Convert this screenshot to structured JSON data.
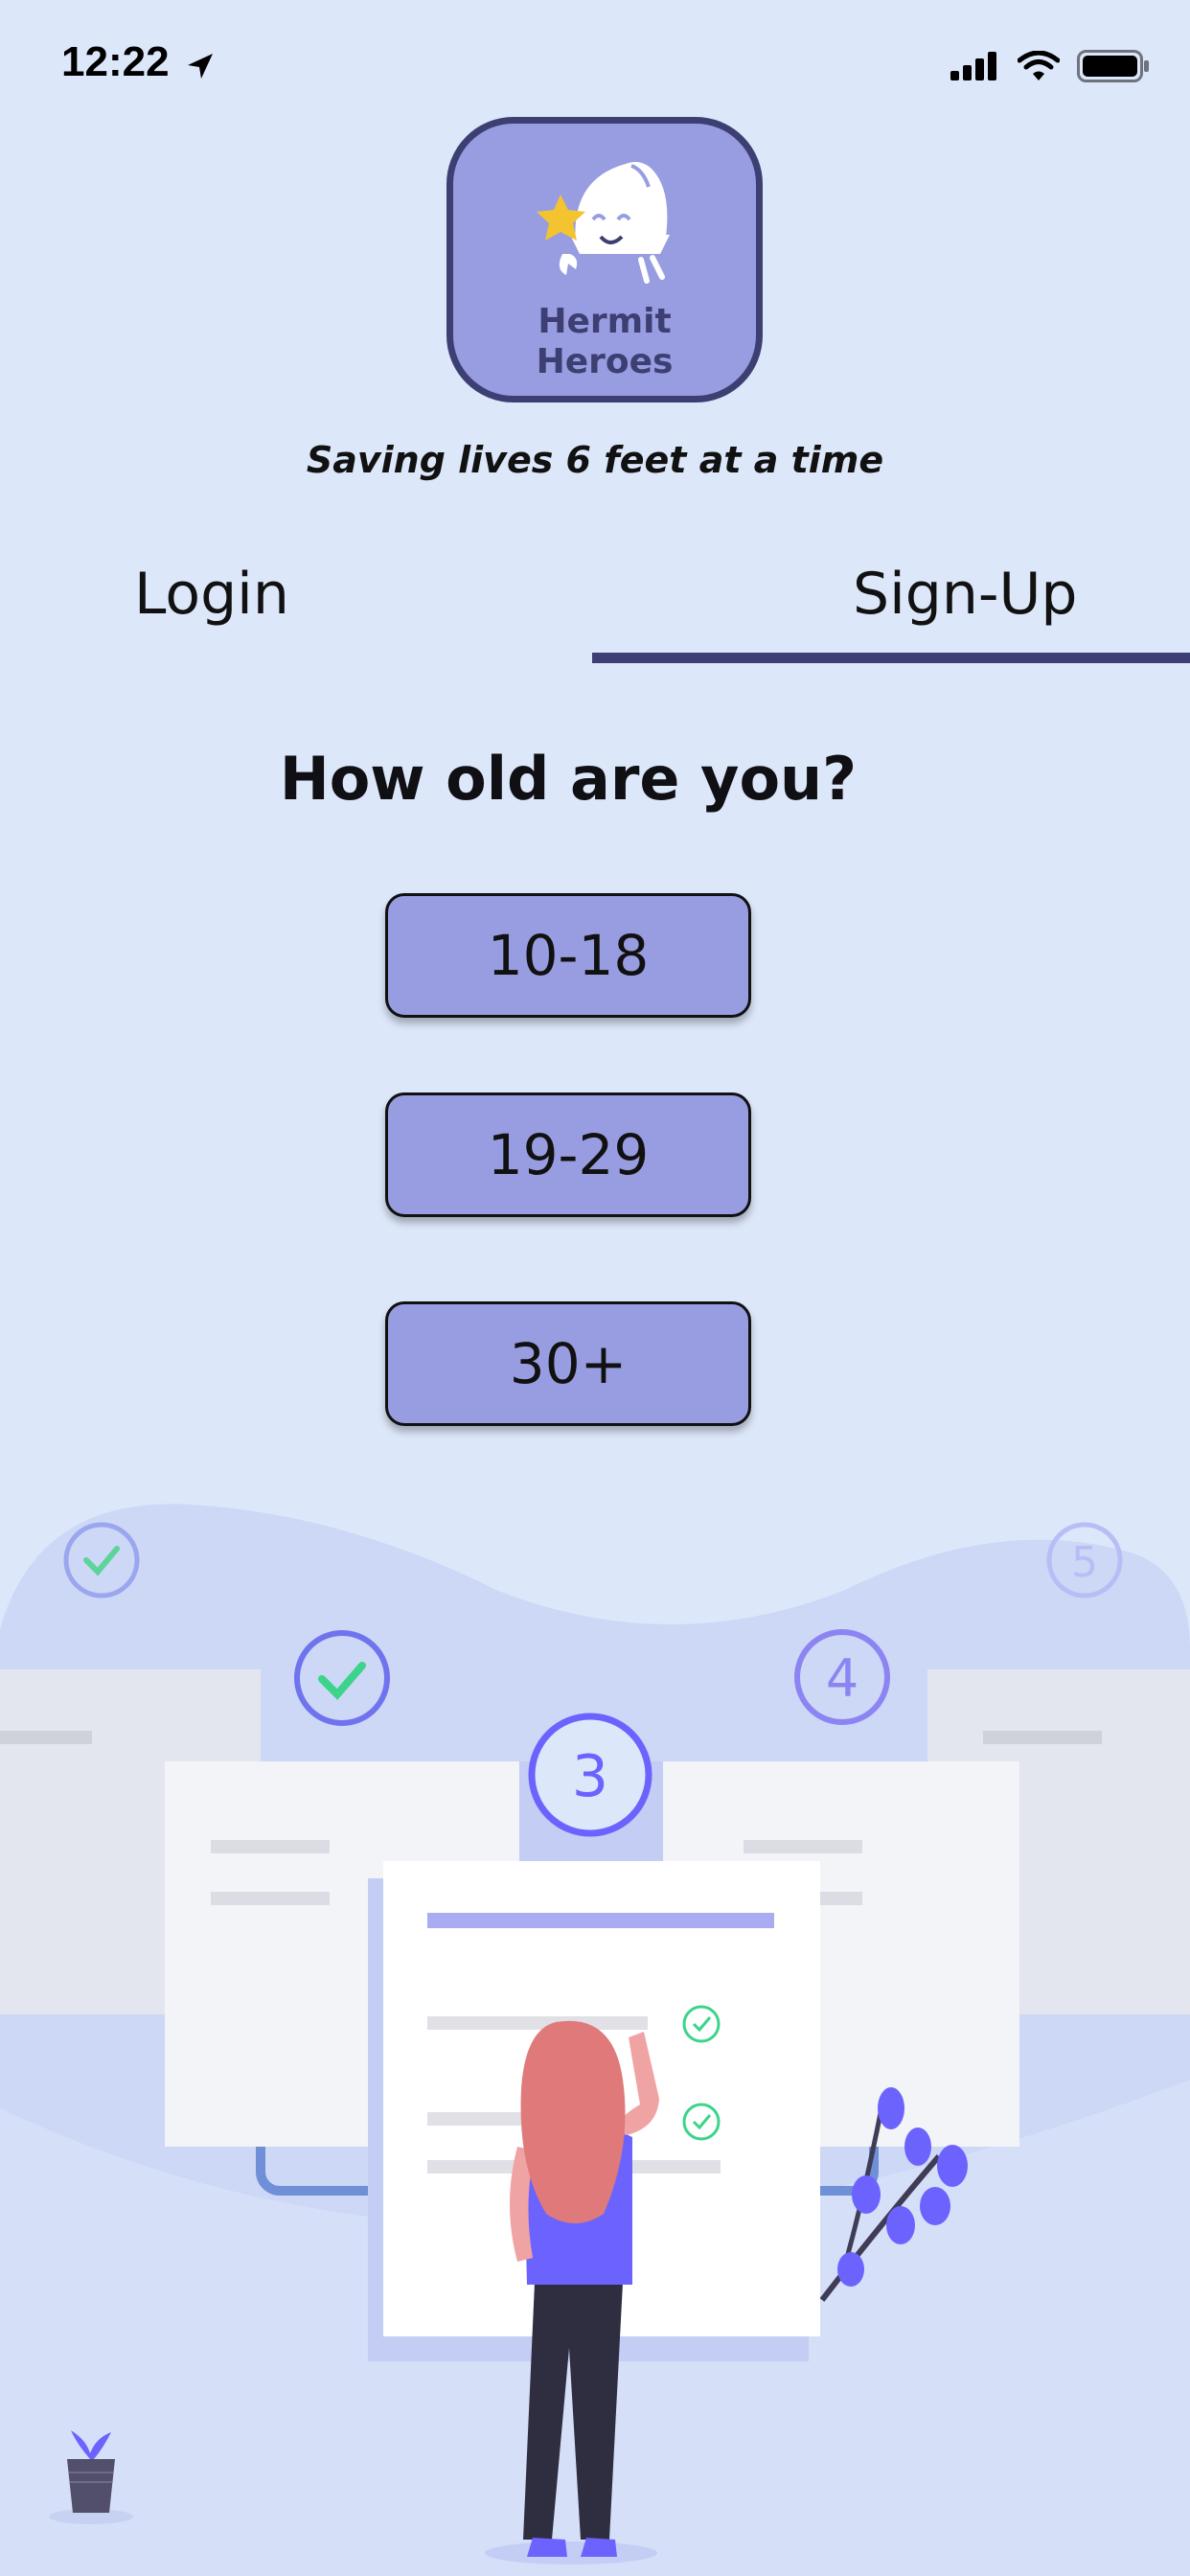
{
  "status": {
    "time": "12:22"
  },
  "app": {
    "name_line1": "Hermit",
    "name_line2": "Heroes",
    "tagline": "Saving lives 6 feet at a time"
  },
  "tabs": {
    "login": "Login",
    "signup": "Sign-Up",
    "active": "signup"
  },
  "question": "How old are you?",
  "age_options": [
    "10-18",
    "19-29",
    "30+"
  ],
  "steps": [
    "3",
    "4",
    "5"
  ],
  "colors": {
    "background": "#dde7fa",
    "button": "#979de0",
    "accent": "#3d3f73",
    "figure": "#6c63ff",
    "check": "#3bd48a"
  }
}
